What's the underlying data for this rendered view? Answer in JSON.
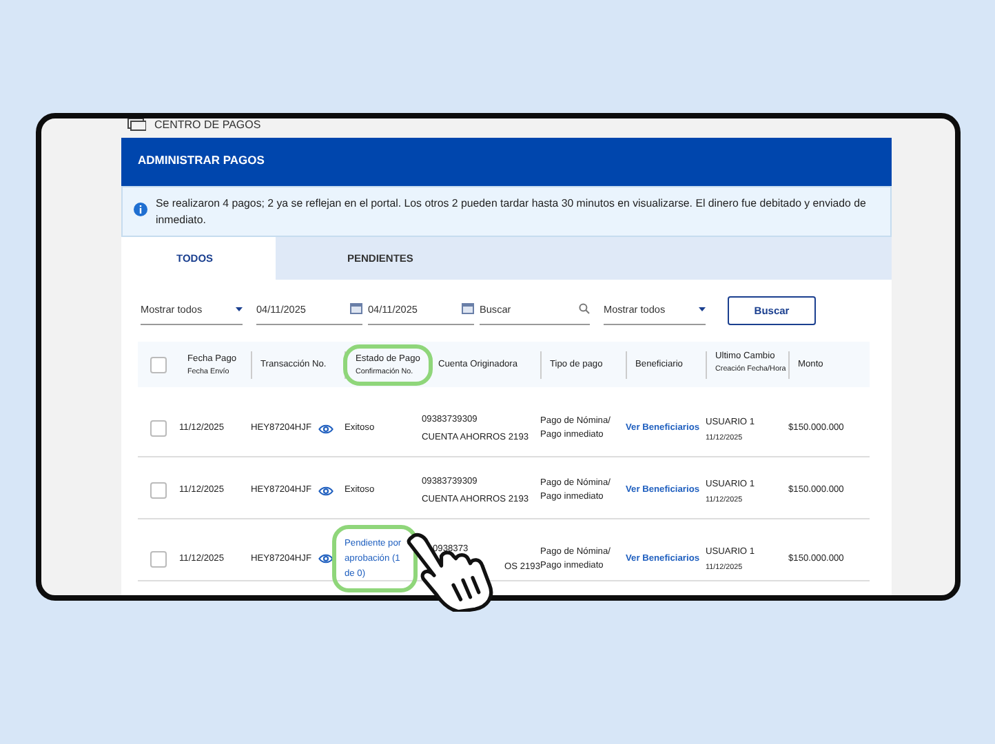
{
  "section": {
    "title": "CENTRO DE PAGOS"
  },
  "banner": {
    "title": "ADMINISTRAR PAGOS"
  },
  "info": {
    "text": "Se realizaron 4 pagos; 2 ya se reflejan en el portal. Los otros 2 pueden tardar hasta 30 minutos en visualizarse. El dinero fue debitado y enviado de inmediato."
  },
  "tabs": [
    {
      "label": "TODOS",
      "selected": true
    },
    {
      "label": "PENDIENTES",
      "selected": false
    }
  ],
  "filters": [
    {
      "kind": "dropdown",
      "value": "Mostrar todos"
    },
    {
      "kind": "date",
      "value": "04/11/2025"
    },
    {
      "kind": "date",
      "value": "04/11/2025"
    },
    {
      "kind": "search",
      "placeholder": "Buscar"
    },
    {
      "kind": "dropdown",
      "value": "Mostrar todos"
    }
  ],
  "search_button": "Buscar",
  "table": {
    "select_all_checked": false,
    "columns": [
      {
        "title": "Fecha Pago",
        "subtitle": "Fecha Envío",
        "highlighted": false
      },
      {
        "title": "Transacción No.",
        "highlighted": false
      },
      {
        "title": "Estado de Pago",
        "subtitle": "Confirmación No.",
        "highlighted": true
      },
      {
        "title": "Cuenta Originadora",
        "highlighted": false
      },
      {
        "title": "Tipo de pago",
        "highlighted": false
      },
      {
        "title": "Beneficiario",
        "highlighted": false
      },
      {
        "title": "Ultimo Cambio",
        "subtitle": "Creación Fecha/Hora",
        "highlighted": false
      },
      {
        "title": "Monto",
        "highlighted": false
      }
    ],
    "rows": [
      {
        "checked": false,
        "date": "11/12/2025",
        "transaction": "HEY87204HJF",
        "status": {
          "kind": "success",
          "text": "Exitoso"
        },
        "highlighted": false,
        "account": [
          "09383739309",
          "CUENTA AHORROS 2193"
        ],
        "payment_type": "Pago de Nómina/ Pago inmediato",
        "beneficiary": "Ver Beneficiarios",
        "changed_by": "USUARIO 1",
        "changed_date": "11/12/2025",
        "amount": "$150.000.000"
      },
      {
        "checked": false,
        "date": "11/12/2025",
        "transaction": "HEY87204HJF",
        "status": {
          "kind": "success",
          "text": "Exitoso"
        },
        "highlighted": false,
        "account": [
          "09383739309",
          "CUENTA AHORROS 2193"
        ],
        "payment_type": "Pago de Nómina/ Pago inmediato",
        "beneficiary": "Ver Beneficiarios",
        "changed_by": "USUARIO 1",
        "changed_date": "11/12/2025",
        "amount": "$150.000.000"
      },
      {
        "checked": false,
        "date": "11/12/2025",
        "transaction": "HEY87204HJF",
        "status": {
          "kind": "pending",
          "text": "Pendiente por aprobación (1 de 0)"
        },
        "highlighted": true,
        "account": [
          "0938373",
          "OS 2193"
        ],
        "payment_type": "Pago de Nómina/ Pago inmediato",
        "beneficiary": "Ver Beneficiarios",
        "changed_by": "USUARIO 1",
        "changed_date": "11/12/2025",
        "amount": "$150.000.000"
      }
    ]
  }
}
